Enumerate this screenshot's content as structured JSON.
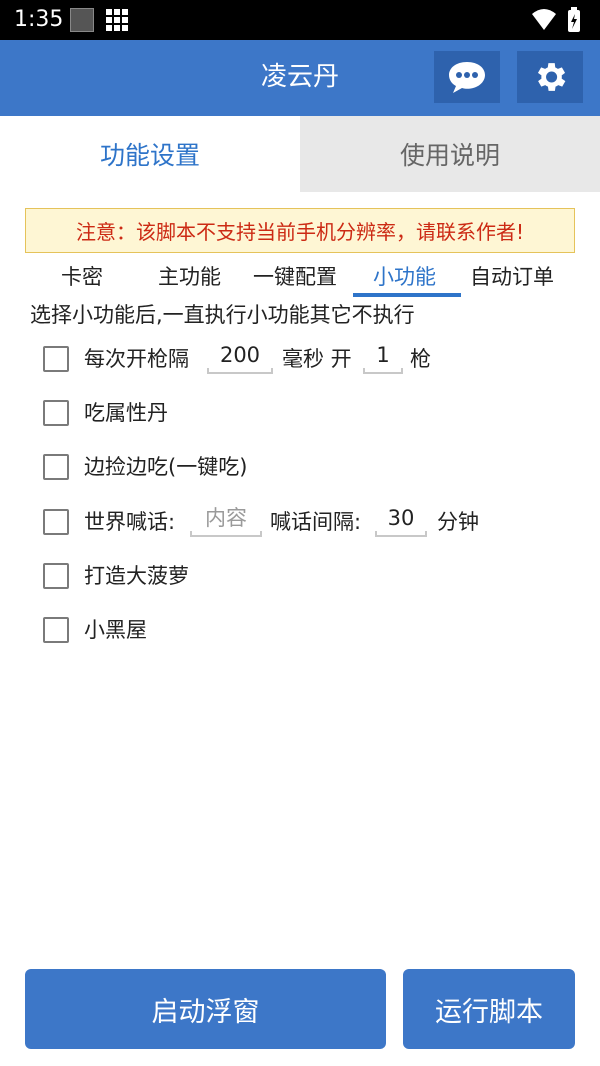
{
  "status_bar": {
    "time": "1:35"
  },
  "app_bar": {
    "title": "凌云丹"
  },
  "tabs": [
    {
      "label": "功能设置",
      "active": true
    },
    {
      "label": "使用说明",
      "active": false
    }
  ],
  "notice": "注意：该脚本不支持当前手机分辨率，请联系作者!",
  "sub_tabs": [
    {
      "label": "卡密"
    },
    {
      "label": "主功能"
    },
    {
      "label": "一键配置"
    },
    {
      "label": "小功能",
      "active": true
    },
    {
      "label": "自动订单"
    }
  ],
  "hint": "选择小功能后,一直执行小功能其它不执行",
  "options": {
    "fire_interval": {
      "label": "每次开枪隔",
      "value": "200",
      "unit": "毫秒 开",
      "count": "1",
      "count_unit": "枪",
      "checked": false
    },
    "eat_attr_pill": {
      "label": "吃属性丹",
      "checked": false
    },
    "pick_eat": {
      "label": "边捡边吃(一键吃)",
      "checked": false
    },
    "world_shout": {
      "label": "世界喊话:",
      "placeholder": "内容",
      "interval_label": "喊话间隔:",
      "interval": "30",
      "interval_unit": "分钟",
      "checked": false
    },
    "pineapple": {
      "label": "打造大菠萝",
      "checked": false
    },
    "black_room": {
      "label": "小黑屋",
      "checked": false
    }
  },
  "buttons": {
    "float_window": "启动浮窗",
    "run_script": "运行脚本"
  },
  "colors": {
    "primary": "#3d77c8",
    "accent_text": "#2e74c9",
    "notice_text": "#cc2a14",
    "notice_bg": "#fef6d4"
  },
  "icons": {
    "chat": "chat-bubble-icon",
    "settings": "gear-icon",
    "wifi": "wifi-icon",
    "battery": "battery-charging-icon",
    "grid": "grid-icon"
  }
}
